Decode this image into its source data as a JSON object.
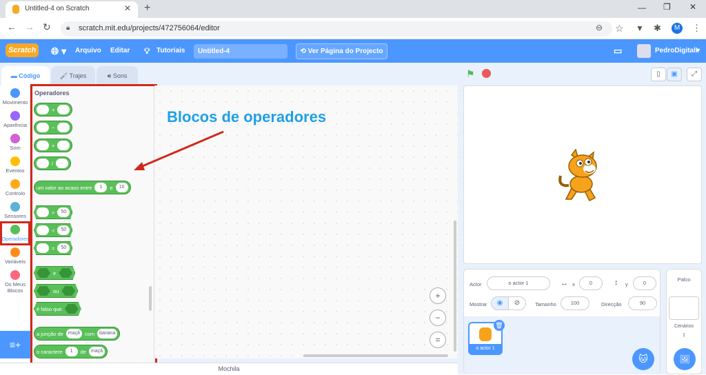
{
  "browser": {
    "tab_title": "Untitled-4 on Scratch",
    "url": "scratch.mit.edu/projects/472756064/editor",
    "avatar_letter": "M"
  },
  "menu": {
    "logo": "Scratch",
    "file": "Arquivo",
    "edit": "Editar",
    "tutorials": "Tutoriais",
    "project_title": "Untitled-4",
    "share": "Ver Página do Projecto",
    "username": "PedroDigitalI"
  },
  "tabs": {
    "code": "Código",
    "costumes": "Trajes",
    "sounds": "Sons"
  },
  "categories": [
    {
      "label": "Movimento",
      "color": "#4c97ff"
    },
    {
      "label": "Aparência",
      "color": "#9966ff"
    },
    {
      "label": "Som",
      "color": "#cf63cf"
    },
    {
      "label": "Eventos",
      "color": "#ffbf00"
    },
    {
      "label": "Controlo",
      "color": "#ffab19"
    },
    {
      "label": "Sensores",
      "color": "#5cb1d6"
    },
    {
      "label": "Operadores",
      "color": "#59c059"
    },
    {
      "label": "Variáveis",
      "color": "#ff8c1a"
    },
    {
      "label": "Os Meus Blocos",
      "color": "#ff6680"
    }
  ],
  "palette": {
    "heading": "Operadores",
    "ops": [
      "+",
      "−",
      "×",
      "/"
    ],
    "random": {
      "text": "um valor ao acaso entre",
      "a": "1",
      "and": "e",
      "b": "10"
    },
    "compare": [
      {
        "op": ">",
        "v": "50"
      },
      {
        "op": "<",
        "v": "50"
      },
      {
        "op": "=",
        "v": "50"
      }
    ],
    "and": "e",
    "or": "ou",
    "not": "é falso que",
    "join": {
      "text": "a junção de",
      "a": "maçã",
      "with": "com",
      "b": "banana"
    },
    "letter": {
      "text": "o caractere",
      "n": "1",
      "of": "de",
      "s": "maçã"
    }
  },
  "annotation": {
    "text": "Blocos de operadores",
    "color": "#1ea0e6"
  },
  "backpack": "Mochila",
  "sprite": {
    "actor_label": "Actor",
    "actor_name": "o actor 1",
    "x_label": "x",
    "x": "0",
    "y_label": "y",
    "y": "0",
    "show_label": "Mostrar",
    "size_label": "Tamanho",
    "size": "100",
    "direction_label": "Direcção",
    "direction": "90",
    "thumb_name": "o actor 1"
  },
  "stage_panel": {
    "title": "Palco",
    "backdrops_label": "Cenários",
    "backdrops": "1"
  }
}
